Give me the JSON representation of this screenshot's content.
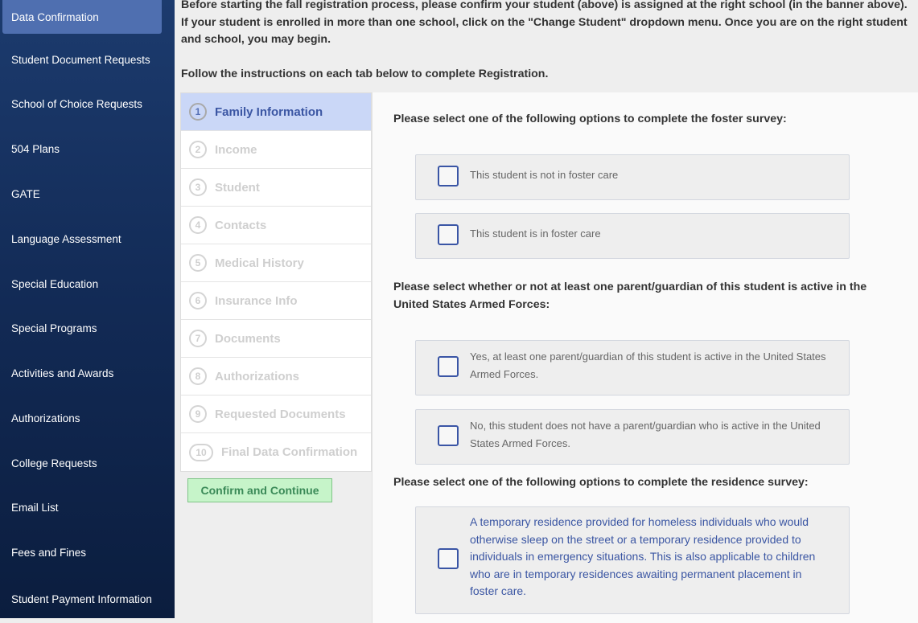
{
  "sidebar": {
    "items": [
      {
        "label": "Data Confirmation"
      },
      {
        "label": "Student Document Requests"
      },
      {
        "label": "School of Choice Requests"
      },
      {
        "label": "504 Plans"
      },
      {
        "label": "GATE"
      },
      {
        "label": "Language Assessment"
      },
      {
        "label": "Special Education"
      },
      {
        "label": "Special Programs"
      },
      {
        "label": "Activities and Awards"
      },
      {
        "label": "Authorizations"
      },
      {
        "label": "College Requests"
      },
      {
        "label": "Email List"
      },
      {
        "label": "Fees and Fines"
      },
      {
        "label": "Student Payment Information"
      }
    ]
  },
  "intro": {
    "paragraph1": "Before starting the fall registration process, please confirm your student (above) is assigned at the right school (in the banner above). If your student is enrolled in more than one school, click on the \"Change Student\" dropdown menu. Once you are on the right student and school, you may begin.",
    "paragraph2": "Follow the instructions on each tab below to complete Registration."
  },
  "steps": [
    {
      "num": "1",
      "label": "Family Information"
    },
    {
      "num": "2",
      "label": "Income"
    },
    {
      "num": "3",
      "label": "Student"
    },
    {
      "num": "4",
      "label": "Contacts"
    },
    {
      "num": "5",
      "label": "Medical History"
    },
    {
      "num": "6",
      "label": "Insurance Info"
    },
    {
      "num": "7",
      "label": "Documents"
    },
    {
      "num": "8",
      "label": "Authorizations"
    },
    {
      "num": "9",
      "label": "Requested Documents"
    },
    {
      "num": "10",
      "label": "Final Data Confirmation"
    }
  ],
  "confirm_button": "Confirm and Continue",
  "questions": {
    "foster": {
      "prompt": "Please select one of the following options to complete the foster survey:",
      "options": [
        "This student is not in foster care",
        "This student is in foster care"
      ]
    },
    "military": {
      "prompt": "Please select whether or not at least one parent/guardian of this student is active in the United States Armed Forces:",
      "options": [
        "Yes, at least one parent/guardian of this student is active in the United States Armed Forces.",
        "No, this student does not have a parent/guardian who is active in the United States Armed Forces."
      ]
    },
    "residence": {
      "prompt": "Please select one of the following options to complete the residence survey:",
      "options": [
        "A temporary residence provided for homeless individuals who would otherwise sleep on the street or a temporary residence provided to individuals in emergency situations. This is also applicable to children who are in temporary residences awaiting permanent placement in foster care."
      ]
    }
  },
  "colors": {
    "sidebar_top": "#1c3b6e",
    "sidebar_active": "#4f6fb0",
    "step_active_bg": "#cad7f7",
    "accent_blue": "#3a55a5",
    "confirm_bg": "#c6f4c9"
  }
}
